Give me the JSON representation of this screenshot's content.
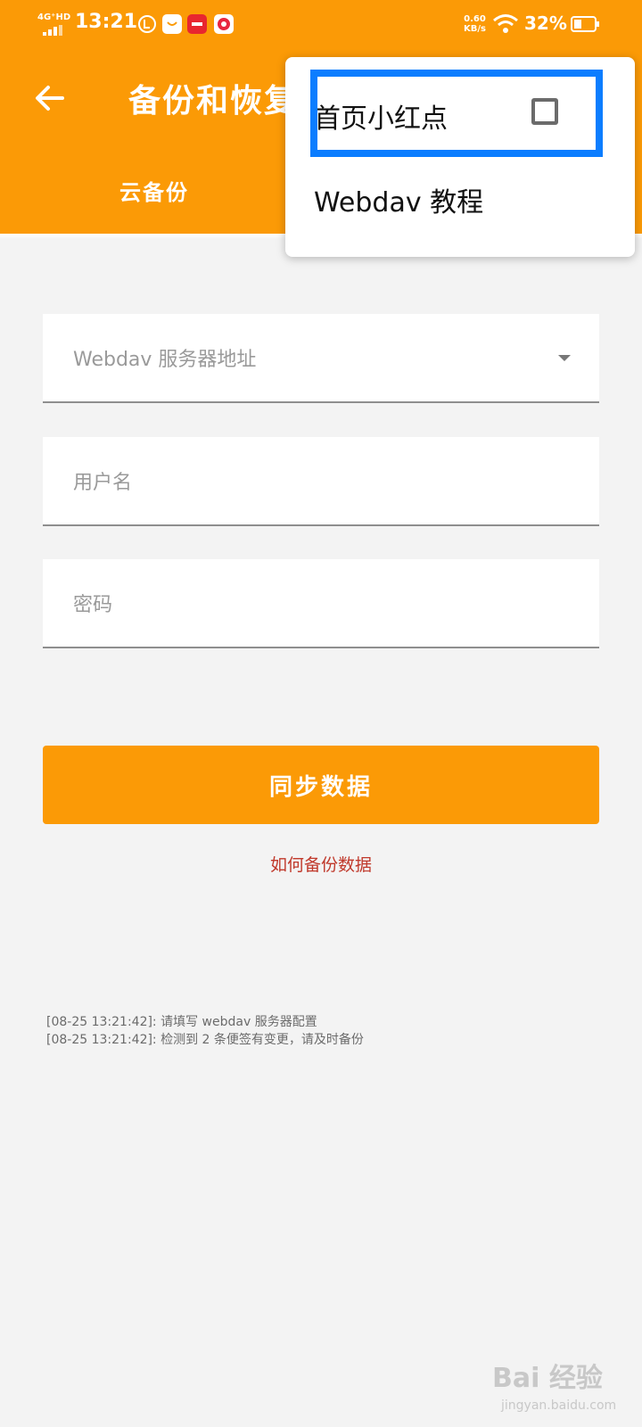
{
  "status_bar": {
    "network": "4G⁺HD",
    "time": "13:21",
    "speed_value": "0.60",
    "speed_unit": "KB/s",
    "battery": "32%",
    "icons": [
      "signal-icon",
      "notification-icon",
      "shop-icon",
      "news-icon",
      "app-icon",
      "wifi-icon",
      "battery-icon"
    ]
  },
  "header": {
    "back_icon": "arrow-left-icon",
    "title": "备份和恢复",
    "tab_cloud_backup": "云备份"
  },
  "form": {
    "server_placeholder": "Webdav 服务器地址",
    "username_placeholder": "用户名",
    "password_placeholder": "密码",
    "sync_button": "同步数据",
    "help_link": "如何备份数据"
  },
  "log": [
    "[08-25 13:21:42]: 请填写 webdav 服务器配置",
    "[08-25 13:21:42]: 检测到 2 条便签有变更，请及时备份"
  ],
  "menu": {
    "items": [
      {
        "label": "首页小红点",
        "checked": false
      },
      {
        "label": "Webdav 教程"
      }
    ]
  },
  "watermark": {
    "main": "Bai 经验",
    "sub": "jingyan.baidu.com"
  },
  "colors": {
    "accent": "#fb9a06",
    "link": "#c0392b",
    "highlight": "#0b7dff",
    "background": "#f3f3f3"
  }
}
